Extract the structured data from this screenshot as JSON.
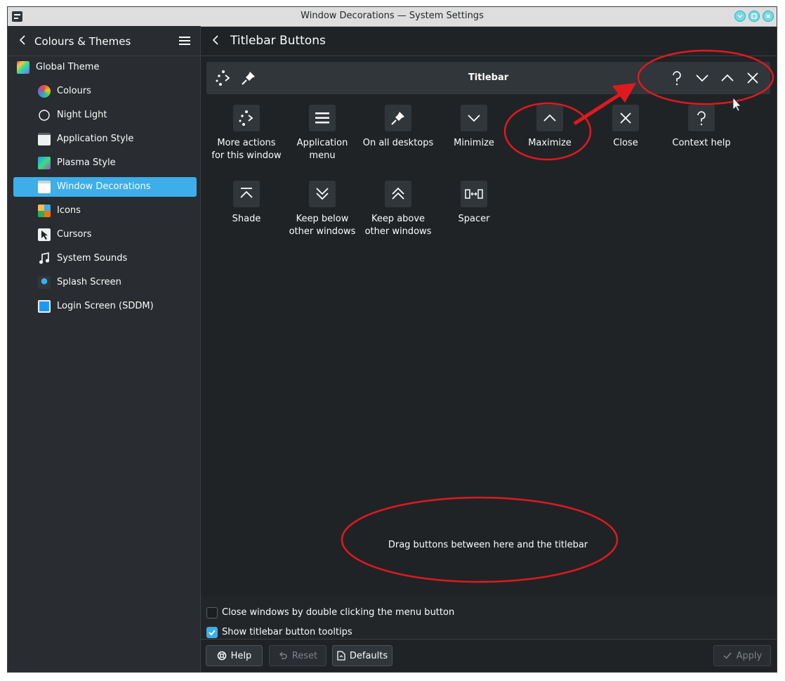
{
  "window": {
    "title": "Window Decorations — System Settings"
  },
  "sidebar": {
    "header_title": "Colours & Themes",
    "items": [
      {
        "label": "Global Theme",
        "icon": "global-theme-icon"
      },
      {
        "label": "Colours",
        "icon": "colours-icon"
      },
      {
        "label": "Night Light",
        "icon": "night-light-icon"
      },
      {
        "label": "Application Style",
        "icon": "application-style-icon"
      },
      {
        "label": "Plasma Style",
        "icon": "plasma-style-icon"
      },
      {
        "label": "Window Decorations",
        "icon": "window-decorations-icon",
        "selected": true
      },
      {
        "label": "Icons",
        "icon": "icons-icon"
      },
      {
        "label": "Cursors",
        "icon": "cursors-icon"
      },
      {
        "label": "System Sounds",
        "icon": "music-note-icon"
      },
      {
        "label": "Splash Screen",
        "icon": "splash-screen-icon"
      },
      {
        "label": "Login Screen (SDDM)",
        "icon": "login-screen-icon"
      }
    ]
  },
  "main": {
    "title": "Titlebar Buttons",
    "preview": {
      "title": "Titlebar",
      "left_buttons": [
        "more-actions-icon",
        "pin-icon"
      ],
      "right_buttons": [
        "question-icon",
        "chevron-down-icon",
        "chevron-up-icon",
        "close-icon"
      ]
    },
    "available_buttons": [
      {
        "line1": "More actions",
        "line2": "for this window",
        "icon": "more-actions-icon"
      },
      {
        "line1": "Application",
        "line2": "menu",
        "icon": "hamburger-menu-icon"
      },
      {
        "line1": "On all desktops",
        "line2": "",
        "icon": "pin-icon"
      },
      {
        "line1": "Minimize",
        "line2": "",
        "icon": "chevron-down-icon"
      },
      {
        "line1": "Maximize",
        "line2": "",
        "icon": "chevron-up-icon"
      },
      {
        "line1": "Close",
        "line2": "",
        "icon": "close-icon"
      },
      {
        "line1": "Context help",
        "line2": "",
        "icon": "question-icon"
      },
      {
        "line1": "Shade",
        "line2": "",
        "icon": "shade-icon"
      },
      {
        "line1": "Keep below",
        "line2": "other windows",
        "icon": "double-chevron-down-icon"
      },
      {
        "line1": "Keep above",
        "line2": "other windows",
        "icon": "double-chevron-up-icon"
      },
      {
        "line1": "Spacer",
        "line2": "",
        "icon": "spacer-icon"
      }
    ],
    "drop_hint": "Drag buttons between here and the titlebar",
    "options": [
      {
        "label": "Close windows by double clicking the menu button",
        "checked": false
      },
      {
        "label": "Show titlebar button tooltips",
        "checked": true
      }
    ]
  },
  "footer": {
    "help": "Help",
    "reset": "Reset",
    "defaults": "Defaults",
    "apply": "Apply"
  },
  "colors": {
    "accent": "#3daee9",
    "background": "#202326",
    "annotation": "#e0191f"
  }
}
